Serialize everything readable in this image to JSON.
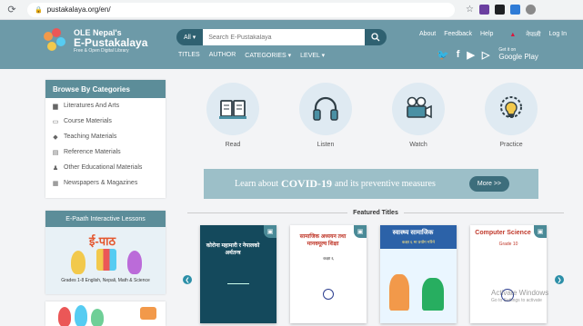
{
  "browser": {
    "url": "pustakalaya.org/en/"
  },
  "header": {
    "logo": {
      "line1": "OLE Nepal's",
      "line2": "E-Pustakalaya",
      "tagline": "Free & Open Digital Library"
    },
    "search": {
      "scope": "All",
      "placeholder": "Search E-Pustakalaya"
    },
    "subnav": [
      "TITLES",
      "AUTHOR",
      "CATEGORIES ▾",
      "LEVEL ▾"
    ],
    "toplinks": [
      "About",
      "Feedback",
      "Help",
      "नेपाली",
      "Log In"
    ],
    "play": {
      "small": "Get it on",
      "big": "Google Play"
    }
  },
  "sidebar": {
    "title": "Browse By Categories",
    "items": [
      {
        "label": "Literatures And Arts",
        "icon": "book-icon"
      },
      {
        "label": "Course Materials",
        "icon": "monitor-icon"
      },
      {
        "label": "Teaching Materials",
        "icon": "graduation-cap-icon"
      },
      {
        "label": "Reference Materials",
        "icon": "archive-icon"
      },
      {
        "label": "Other Educational Materials",
        "icon": "person-icon"
      },
      {
        "label": "Newspapers & Magazines",
        "icon": "newspaper-icon"
      }
    ]
  },
  "epath": {
    "title": "E-Paath Interactive Lessons",
    "logo_text": "ई-पाठ",
    "subtitle": "Grades 1-8 English, Nepali, Math & Science"
  },
  "categories": [
    {
      "label": "Read",
      "icon": "open-book-icon"
    },
    {
      "label": "Listen",
      "icon": "headphones-icon"
    },
    {
      "label": "Watch",
      "icon": "video-camera-icon"
    },
    {
      "label": "Practice",
      "icon": "lightbulb-gear-icon"
    }
  ],
  "covid": {
    "pre": "Learn about",
    "bold": "COVID-19",
    "post": "and its preventive measures",
    "button": "More >>"
  },
  "featured": {
    "heading": "Featured Titles",
    "books": [
      {
        "title": "कोरोना महामारी र नेपालको अर्थतन्त्र",
        "author": ""
      },
      {
        "title": "सामाजिक अध्ययन तथा मानवमूल्य शिक्षा",
        "author": "कक्षा ६"
      },
      {
        "title": "स्वास्थ्य सामाजिक",
        "author": "कक्षा ६ मा प्रयोग गरिने"
      },
      {
        "title": "Computer Science",
        "author": "Grade 10"
      }
    ]
  },
  "watermark": {
    "line1": "Activate Windows",
    "line2": "Go to Settings to activate"
  }
}
